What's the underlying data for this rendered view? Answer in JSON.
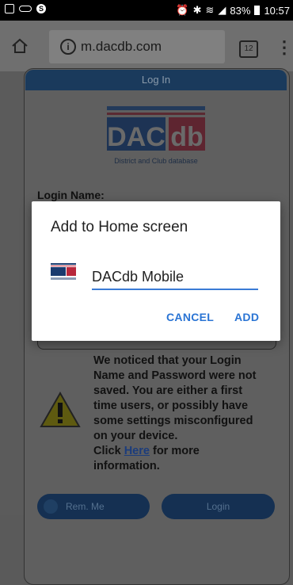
{
  "status_bar": {
    "battery_percent": "83%",
    "time": "10:57"
  },
  "browser": {
    "url": "m.dacdb.com",
    "tab_count": "12"
  },
  "page": {
    "header_title": "Log In",
    "logo": {
      "line1_left": "DAC",
      "line1_right": "db",
      "tagline": "District and Club database"
    },
    "login_name_label": "Login Name:",
    "notice_lines": [
      "We noticed that your Login",
      "Name and Password were not",
      "saved. You are either a first",
      "time users, or possibly have",
      "some settings misconfigured",
      "on your device."
    ],
    "notice_click": "Click",
    "notice_link": "Here",
    "notice_tail": "for more",
    "notice_last": "information.",
    "rem_me_label": "Rem. Me",
    "login_button_label": "Login"
  },
  "dialog": {
    "title": "Add to Home screen",
    "shortcut_name": "DACdb Mobile",
    "cancel_label": "CANCEL",
    "add_label": "ADD"
  },
  "colors": {
    "accent": "#2a74d4",
    "logo_navy": "#1a3a6e",
    "logo_red": "#b8283c"
  }
}
